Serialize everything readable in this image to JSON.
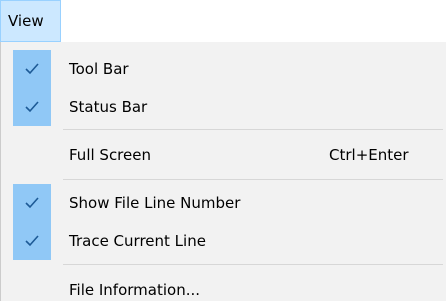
{
  "menubar": {
    "view_label": "View"
  },
  "menu": {
    "items": [
      {
        "label": "Tool Bar",
        "checked": true
      },
      {
        "label": "Status Bar",
        "checked": true
      },
      {
        "label": "Full Screen",
        "shortcut": "Ctrl+Enter",
        "checked": false
      },
      {
        "label": "Show File Line Number",
        "checked": true
      },
      {
        "label": "Trace Current Line",
        "checked": true
      },
      {
        "label": "File Information...",
        "checked": false
      }
    ]
  },
  "colors": {
    "menubar_highlight": "#cce8ff",
    "menu_background": "#f2f2f2",
    "check_background": "#90c8f6",
    "checkmark": "#1d5a96"
  },
  "icons": {
    "check": "checkmark-icon"
  }
}
